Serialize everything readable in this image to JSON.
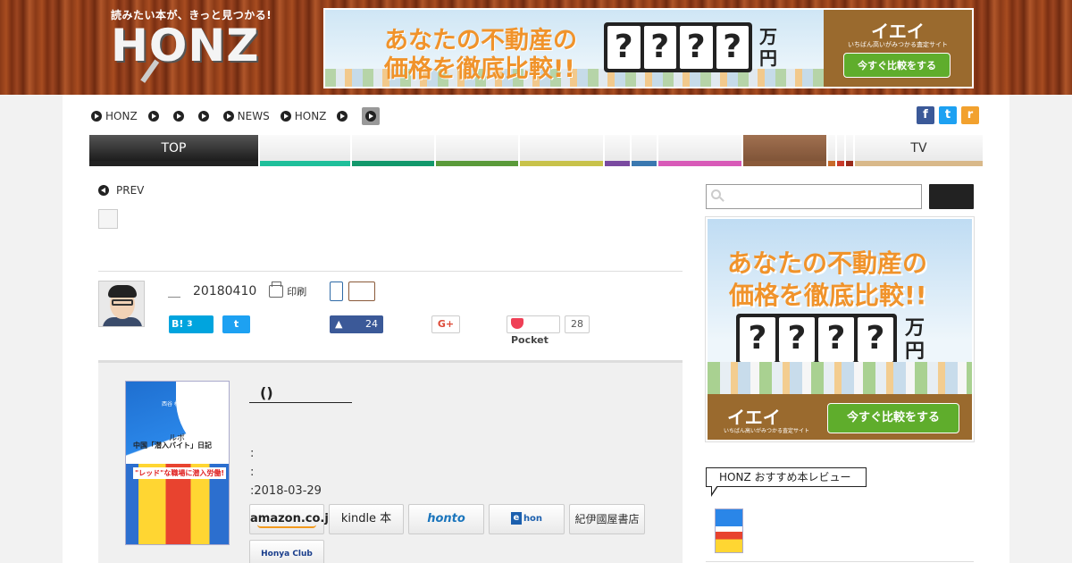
{
  "header": {
    "tagline": "読みたい本が、きっと見つかる!",
    "logo_text": "HONZ"
  },
  "top_ad": {
    "headline_line1": "あなたの不動産の",
    "headline_line2": "価格を徹底比較!!",
    "question_marks": [
      "?",
      "?",
      "?",
      "?"
    ],
    "unit_line1": "万",
    "unit_line2": "円",
    "brand": "イエイ",
    "brand_sub": "いちばん高いがみつかる査定サイト",
    "cta_label": "今すぐ比較をする"
  },
  "breadcrumb": {
    "items": [
      "HONZ",
      "",
      "",
      "",
      "NEWS",
      "HONZ",
      ""
    ]
  },
  "social_top": {
    "facebook": "f",
    "twitter": "t",
    "rss": "r"
  },
  "category_nav": {
    "items": [
      {
        "label": "TOP",
        "color": "#222222"
      },
      {
        "label": "",
        "color": "#1fbf9a"
      },
      {
        "label": "",
        "color": "#12986b"
      },
      {
        "label": "",
        "color": "#5a9a3a"
      },
      {
        "label": "",
        "color": "#c8c24a"
      },
      {
        "label": "",
        "color": "#7a4aa0"
      },
      {
        "label": "",
        "color": "#3a78b0"
      },
      {
        "label": "",
        "color": "#d85ab8"
      },
      {
        "label": "",
        "color": "#8a5a3a"
      },
      {
        "label": "",
        "color": "#c86a2a"
      },
      {
        "label": "",
        "color": "#c83a2a"
      },
      {
        "label": "",
        "color": "#9a2a1a"
      },
      {
        "label": "TV",
        "color": "#d9b98a"
      }
    ]
  },
  "article": {
    "prev_label": "PREV",
    "author_sep": "＿",
    "date": "20180410",
    "print_label": "印刷",
    "share": {
      "hatebu_label": "B!",
      "hatebu_count": "3",
      "twitter_glyph": "t",
      "fb_like_count": "24",
      "gplus_label": "G+",
      "pocket_label": "Pocket",
      "pocket_count": "28"
    }
  },
  "book": {
    "title": "()",
    "meta_line1": ":",
    "meta_line2": ":",
    "meta_line3": ":2018-03-29",
    "cover_author": "西谷 格",
    "cover_title1": "ルポ",
    "cover_title2": "中国「潜入バイト」日記",
    "cover_band": "\"レッド\"な職場に潜入労働!",
    "stores": {
      "amazon": "amazon.co.jp",
      "kindle": "kindle 本",
      "honto": "honto",
      "ehon": "hon",
      "kinokuniya": "紀伊國屋書店",
      "honya": "Honya Club"
    }
  },
  "sidebar": {
    "search_placeholder": "",
    "side_ad": {
      "headline_line1": "あなたの不動産の",
      "headline_line2": "価格を徹底比較!!",
      "question_marks": [
        "?",
        "?",
        "?",
        "?"
      ],
      "unit_line1": "万",
      "unit_line2": "円",
      "brand": "イエイ",
      "brand_sub": "いちばん高いがみつかる査定サイト",
      "cta_label": "今すぐ比較をする"
    },
    "recommend_heading": "HONZ おすすめ本レビュー"
  }
}
